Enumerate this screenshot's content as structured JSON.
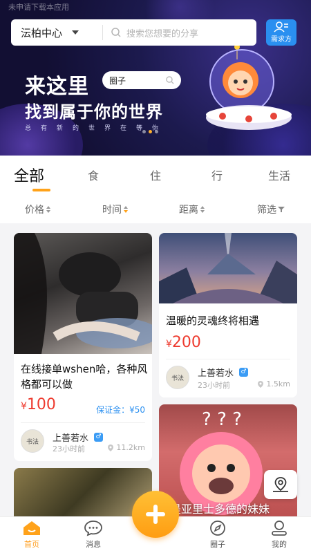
{
  "status_bar": {
    "text": "未申请下载本应用"
  },
  "header": {
    "location": "沄柏中心",
    "search_placeholder": "搜索您想要的分享",
    "demand_label": "需求方"
  },
  "banner": {
    "line1": "来这里",
    "line2": "找到属于你的世界",
    "subtitle": "总有新的世界在等你",
    "pill_label": "圈子",
    "active_dot": 1
  },
  "categories": {
    "tabs": [
      "全部",
      "食",
      "住",
      "行",
      "生活"
    ],
    "active": 0
  },
  "sorts": [
    "价格",
    "时间",
    "距离",
    "筛选"
  ],
  "cards": [
    {
      "title": "在线接单wshen哈，各种风格都可以做",
      "price_symbol": "¥",
      "price": "100",
      "deposit": "保证金：¥50",
      "user": "上善若水",
      "gender": "♂",
      "time": "23小时前",
      "distance": "11.2km"
    },
    {
      "title": "温暖的灵魂终将相遇",
      "price_symbol": "¥",
      "price": "200",
      "user": "上善若水",
      "gender": "♂",
      "time": "23小时前",
      "distance": "1.5km"
    },
    {
      "overlay_title": "是亚里士多德的妹妹"
    }
  ],
  "nav": {
    "items": [
      "首页",
      "消息",
      "圈子",
      "我的"
    ],
    "active": 0
  },
  "colors": {
    "accent": "#ffa21a",
    "price": "#ee3b2f",
    "link_blue": "#2a8ff0"
  },
  "icons": [
    "search-icon",
    "demand-icon",
    "map-pin-icon",
    "home-icon",
    "message-icon",
    "compass-icon",
    "profile-icon",
    "plus-icon",
    "location-icon"
  ]
}
